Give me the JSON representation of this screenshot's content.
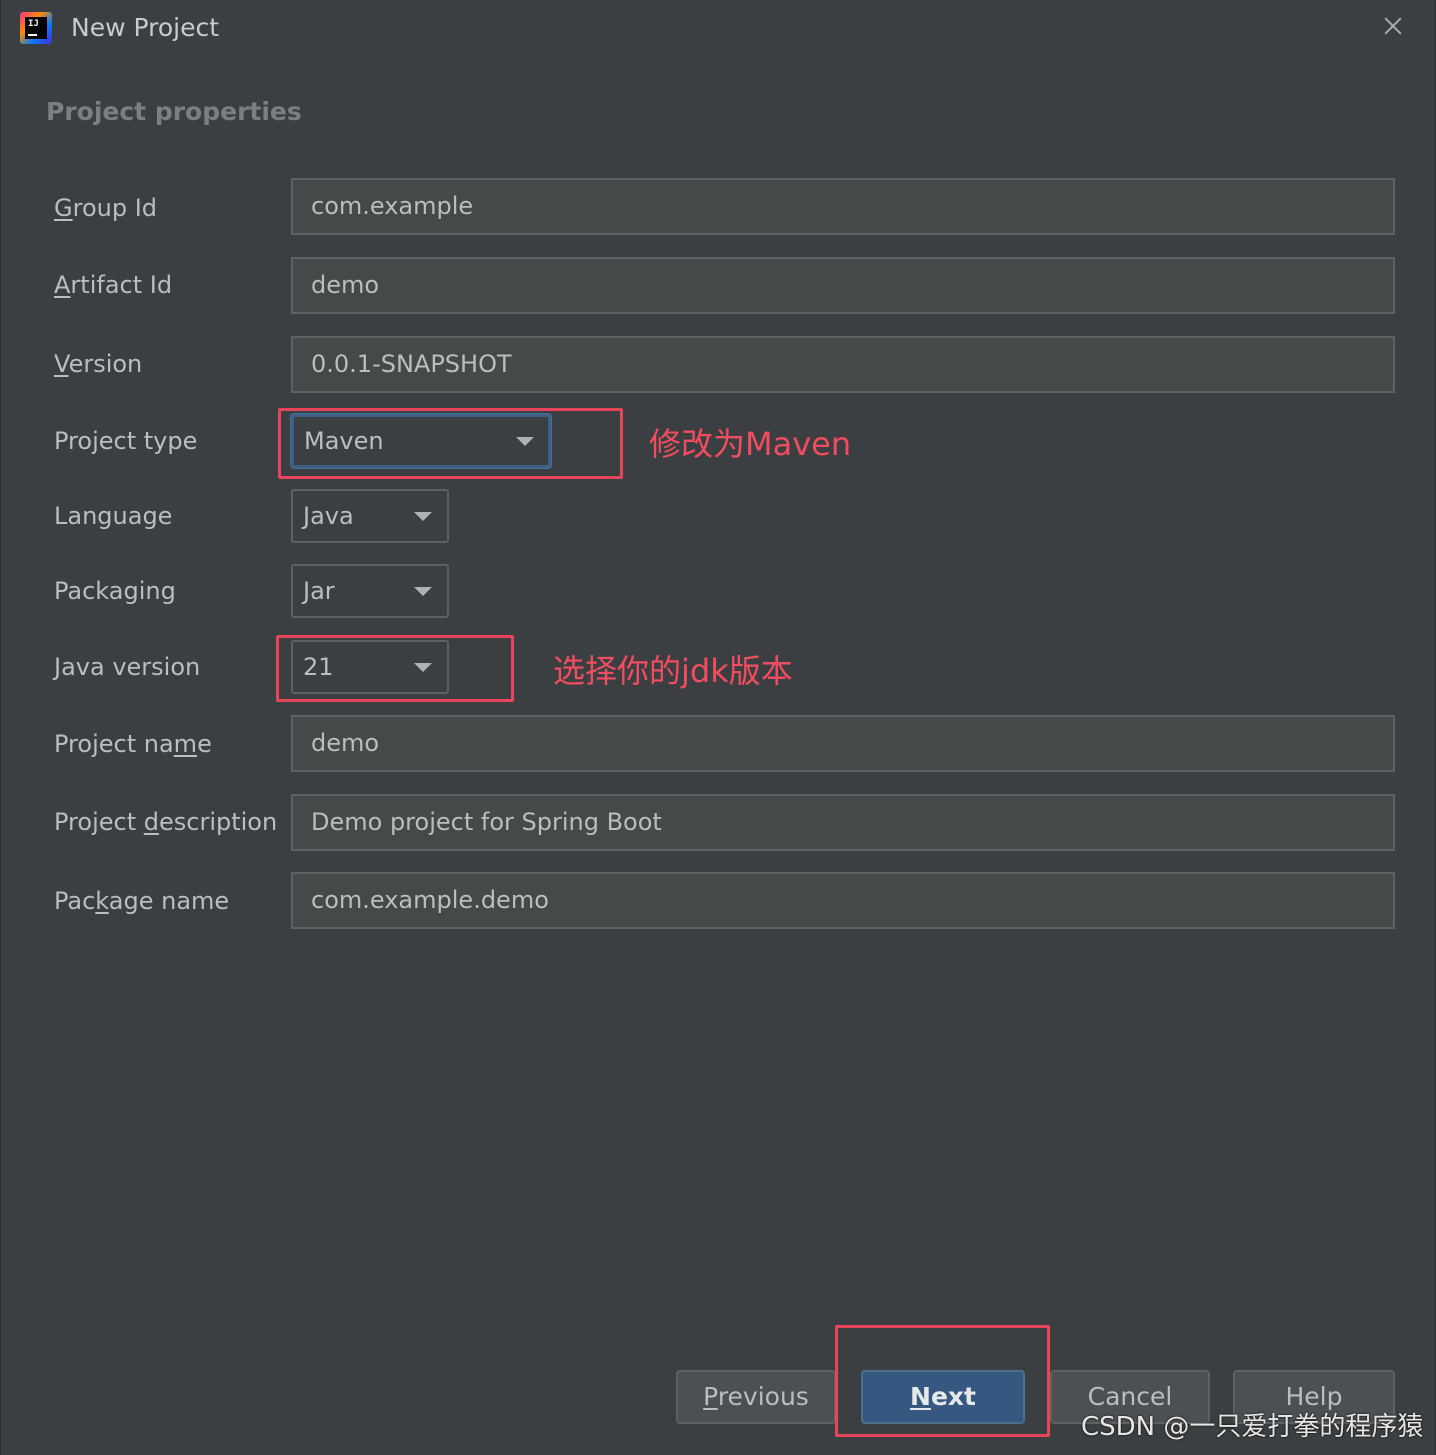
{
  "window": {
    "title": "New Project",
    "section_title": "Project properties"
  },
  "fields": {
    "group_id": {
      "label_pre": "",
      "label_mn": "G",
      "label_post": "roup Id",
      "value": "com.example"
    },
    "artifact_id": {
      "label_pre": "",
      "label_mn": "A",
      "label_post": "rtifact Id",
      "value": "demo"
    },
    "version": {
      "label_pre": "",
      "label_mn": "V",
      "label_post": "ersion",
      "value": "0.0.1-SNAPSHOT"
    },
    "project_type": {
      "label": "Project type",
      "value": "Maven"
    },
    "language": {
      "label": "Language",
      "value": "Java"
    },
    "packaging": {
      "label": "Packaging",
      "value": "Jar"
    },
    "java_version": {
      "label": "Java version",
      "value": "21"
    },
    "project_name": {
      "label_pre": "Project na",
      "label_mn": "m",
      "label_post": "e",
      "value": "demo"
    },
    "project_description": {
      "label_pre": "Project ",
      "label_mn": "d",
      "label_post": "escription",
      "value": "Demo project for Spring Boot"
    },
    "package_name": {
      "label_pre": "Pac",
      "label_mn": "k",
      "label_post": "age name",
      "value": "com.example.demo"
    }
  },
  "annotations": {
    "project_type_note": "修改为Maven",
    "java_version_note": "选择你的jdk版本"
  },
  "buttons": {
    "previous": {
      "mn": "P",
      "rest": "revious"
    },
    "next": {
      "mn": "N",
      "rest": "ext"
    },
    "cancel": "Cancel",
    "help": "Help"
  },
  "watermark": "CSDN @一只爱打拳的程序猿",
  "colors": {
    "background": "#3c3f41",
    "field_background": "#45494a",
    "primary_button": "#365880",
    "annotation_red": "#e8455a"
  }
}
